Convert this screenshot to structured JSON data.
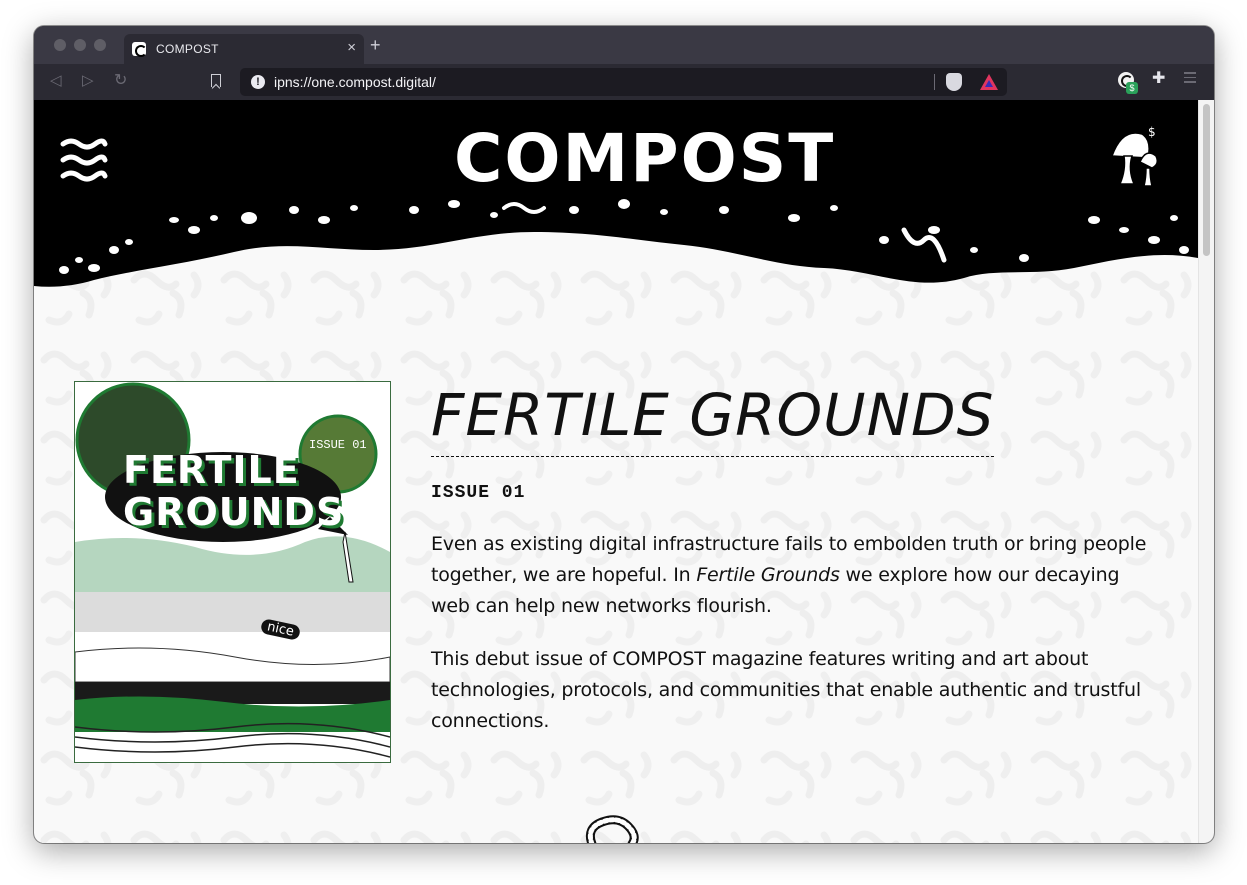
{
  "browser": {
    "tab_title": "COMPOST",
    "tab_close": "×",
    "new_tab": "+",
    "url": "ipns://one.compost.digital/",
    "nav_back": "◁",
    "nav_forward": "▷",
    "nav_reload": "↻",
    "info_glyph": "!",
    "extension_badge": "$",
    "puzzle_glyph": "✚"
  },
  "site": {
    "logo": "COMPOST"
  },
  "cover": {
    "title_line1": "FERTILE",
    "title_line2": "GROUNDS",
    "badge": "ISSUE 01",
    "tag": "nice"
  },
  "issue": {
    "title": "FERTILE GROUNDS",
    "number": "ISSUE 01",
    "para1_a": "Even as existing digital infrastructure fails to embolden truth or bring people together, we are hopeful. In ",
    "para1_em": "Fertile Grounds",
    "para1_b": " we explore how our decaying web can help new networks flourish.",
    "para2": "This debut issue of COMPOST magazine features writing and art about technologies, protocols, and communities that enable authentic and trustful connections."
  },
  "colors": {
    "accent_green": "#1f7a32",
    "header_black": "#000000"
  }
}
